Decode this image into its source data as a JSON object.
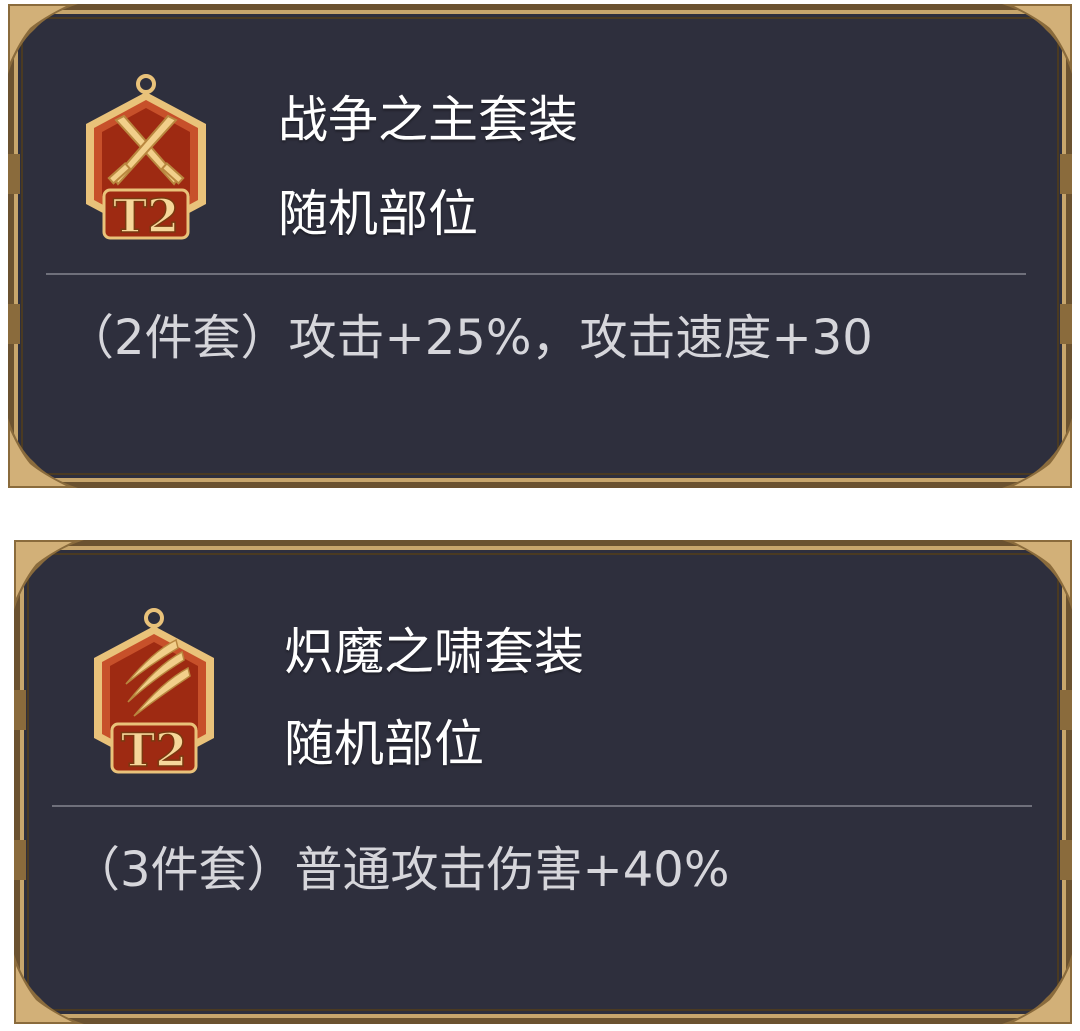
{
  "colors": {
    "panel_bg": "#2e2f3d",
    "frame_gold": "#c8a66c",
    "frame_dark": "#6b5230",
    "badge_red": "#9e2a12",
    "badge_gold": "#e9c27a",
    "title_text": "#ffffff",
    "effect_text": "#d6d6db",
    "divider": "#6f707b"
  },
  "cards": [
    {
      "badge": {
        "icon": "crossed-swords-icon",
        "tier": "T2"
      },
      "title": "战争之主套装",
      "subtitle": "随机部位",
      "effect": "（2件套）攻击+25%，攻击速度+30"
    },
    {
      "badge": {
        "icon": "claw-slash-icon",
        "tier": "T2"
      },
      "title": "炽魔之啸套装",
      "subtitle": "随机部位",
      "effect": "（3件套）普通攻击伤害+40%"
    }
  ]
}
